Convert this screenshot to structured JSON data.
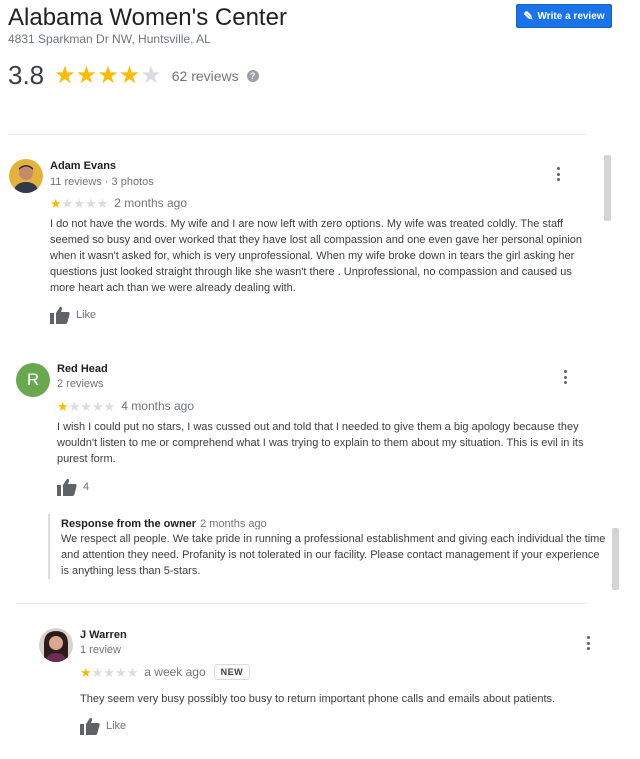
{
  "business": {
    "name": "Alabama Women's Center",
    "address": "4831 Sparkman Dr NW, Huntsville, AL",
    "rating": "3.8",
    "rating_value": 3.8,
    "review_count": "62 reviews",
    "write_review_label": "Write a review",
    "help_icon": "?"
  },
  "colors": {
    "accent": "#1a73e8",
    "star": "#fbbc04",
    "star_off": "#dadce0"
  },
  "reviews": [
    {
      "name": "Adam Evans",
      "meta": "11 reviews · 3 photos",
      "stars": 1,
      "date": "2 months ago",
      "text": "I do not have the words.  My wife and I are now left with zero options.  My wife was treated coldly.  The staff seemed so busy and over worked that they have lost all compassion and one even gave her personal opinion when it wasn't asked for,  which is very unprofessional. When my wife broke down in tears the girl asking her questions just looked straight through like she wasn't there . Unprofessional,  no compassion and caused us more heart ach than we were already dealing with.",
      "like_label": "Like"
    },
    {
      "name": "Red Head",
      "avatar_letter": "R",
      "meta": "2 reviews",
      "stars": 1,
      "date": "4 months ago",
      "text": "I wish I could put no stars, I was cussed out and told that I needed to give them a big apology because they wouldn't listen to me or comprehend what I was trying to explain to them about my situation. This is evil in its purest form.",
      "like_label": "4",
      "owner_response": {
        "heading": "Response from the owner",
        "date": "2 months ago",
        "text": "We respect all people. We take pride in running a professional establishment and giving each individual the time and attention they need. Profanity is not tolerated in our facility. Please contact management if your experience is anything less than 5-stars."
      }
    },
    {
      "name": "J Warren",
      "meta": "1 review",
      "stars": 1,
      "date": "a week ago",
      "badge": "NEW",
      "text": "They seem very busy possibly too busy to return important phone calls and emails about patients.",
      "like_label": "Like"
    }
  ]
}
